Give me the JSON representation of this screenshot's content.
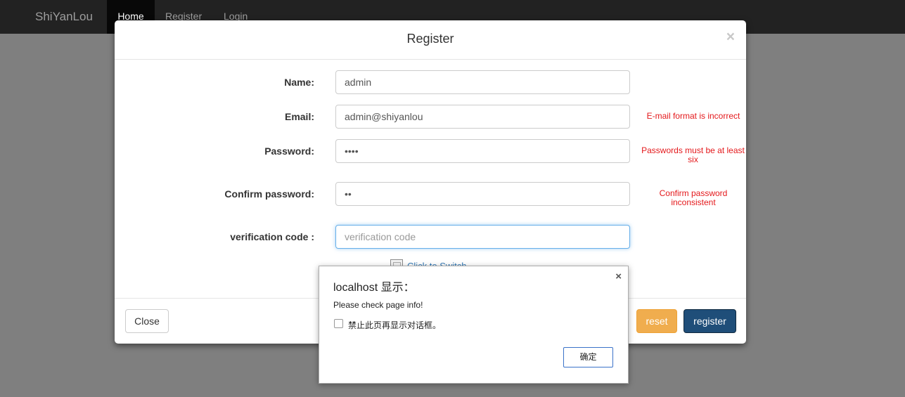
{
  "navbar": {
    "brand": "ShiYanLou",
    "items": [
      {
        "label": "Home",
        "active": true
      },
      {
        "label": "Register",
        "active": false
      },
      {
        "label": "Login",
        "active": false
      }
    ]
  },
  "modal": {
    "title": "Register",
    "close_symbol": "×",
    "fields": {
      "name": {
        "label": "Name:",
        "value": "admin"
      },
      "email": {
        "label": "Email:",
        "value": "admin@shiyanlou",
        "error": "E-mail format is incorrect"
      },
      "password": {
        "label": "Password:",
        "value": "••••",
        "error_line1": "Passwords must be at least",
        "error_line2": "six"
      },
      "confirm": {
        "label": "Confirm password:",
        "value": "••",
        "error_line1": "Confirm password",
        "error_line2": "inconsistent"
      },
      "verification": {
        "label": "verification code :",
        "value": "",
        "placeholder": "verification code"
      }
    },
    "captcha_link": "Click to Switch",
    "footer": {
      "close_label": "Close",
      "reset_label": "reset",
      "register_label": "register"
    }
  },
  "dialog": {
    "title": "localhost 显示：",
    "close_symbol": "×",
    "message": "Please check page info!",
    "checkbox_label": "禁止此页再显示对话框。",
    "ok_label": "确定"
  },
  "colors": {
    "navbar_bg": "#222222",
    "backdrop": "#7f7f7f",
    "error_text": "#e4181b",
    "reset_button": "#f0ad4e",
    "register_button": "#1f4e79",
    "link": "#337ab7"
  },
  "icons": {
    "modal_close": "close-icon",
    "captcha": "broken-image-icon",
    "dialog_close": "close-icon"
  }
}
